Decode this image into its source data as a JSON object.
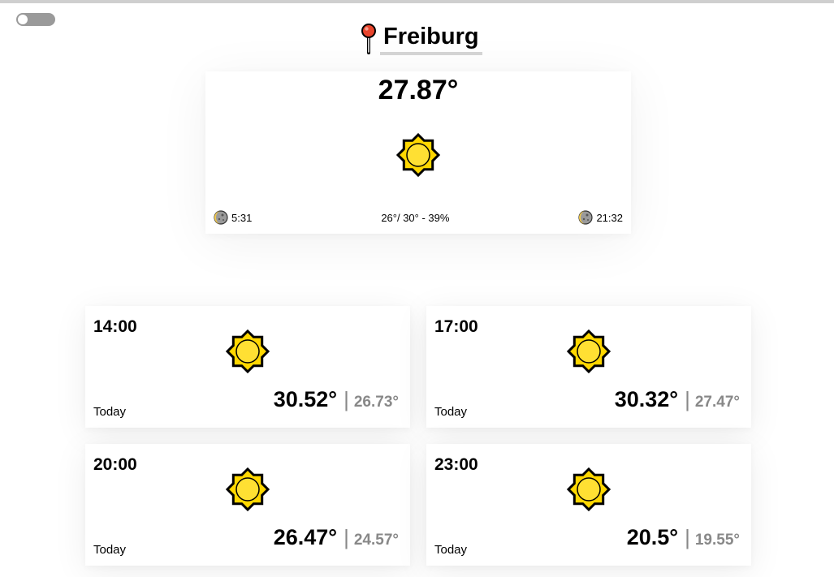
{
  "header": {
    "toggle_state": "off",
    "city": "Freiburg",
    "pin_icon": "map-pin-icon"
  },
  "current": {
    "temp": "27.87°",
    "condition_icon": "sun-icon",
    "sunrise": "5:31",
    "sunset": "21:32",
    "summary": "26°/ 30° - 39%",
    "sunrise_icon": "moon-icon",
    "sunset_icon": "moon-icon"
  },
  "forecast": [
    {
      "time": "14:00",
      "day": "Today",
      "temp": "30.52°",
      "feels": "26.73°",
      "icon": "sun-icon"
    },
    {
      "time": "17:00",
      "day": "Today",
      "temp": "30.32°",
      "feels": "27.47°",
      "icon": "sun-icon"
    },
    {
      "time": "20:00",
      "day": "Today",
      "temp": "26.47°",
      "feels": "24.57°",
      "icon": "sun-icon"
    },
    {
      "time": "23:00",
      "day": "Today",
      "temp": "20.5°",
      "feels": "19.55°",
      "icon": "sun-icon"
    }
  ],
  "colors": {
    "sun_fill": "#FFD700",
    "sun_outline": "#000000",
    "pin_head": "#E8442C",
    "secondary_text": "#888888"
  }
}
